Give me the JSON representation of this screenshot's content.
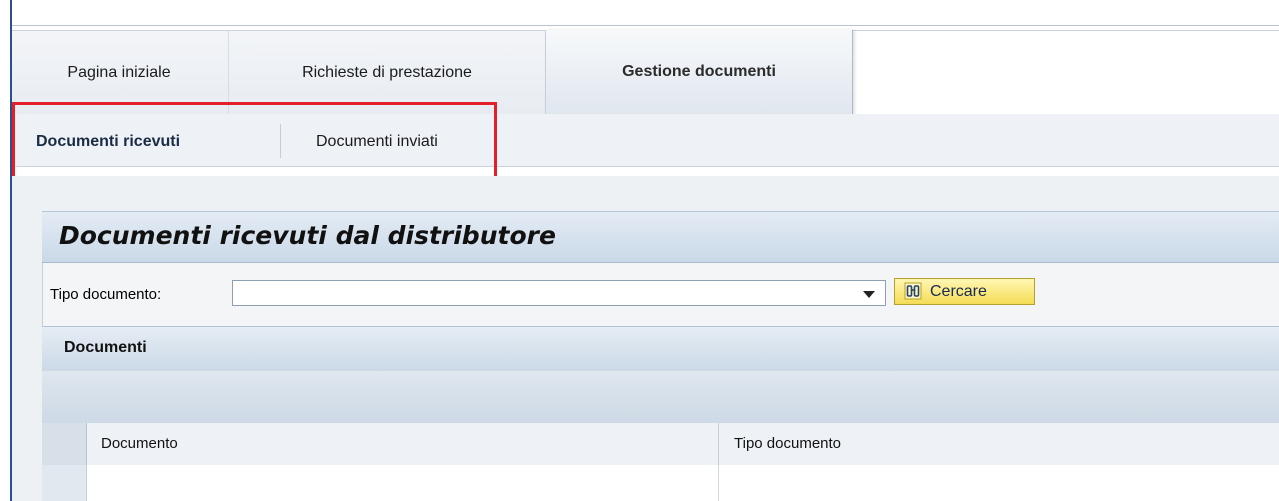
{
  "tabs": [
    {
      "label": "Pagina iniziale",
      "active": false
    },
    {
      "label": "Richieste di prestazione",
      "active": false
    },
    {
      "label": "Gestione documenti",
      "active": true
    }
  ],
  "subtabs": [
    {
      "label": "Documenti ricevuti",
      "active": true
    },
    {
      "label": "Documenti inviati",
      "active": false
    }
  ],
  "panel": {
    "title": "Documenti ricevuti dal distributore"
  },
  "filter": {
    "label": "Tipo documento:",
    "value": "",
    "search_label": "Cercare"
  },
  "table": {
    "title": "Documenti",
    "columns": [
      "Documento",
      "Tipo documento"
    ],
    "rows": [
      [
        "",
        ""
      ]
    ]
  },
  "colors": {
    "highlight": "#e3202a",
    "search_button": "#f4dc55",
    "header_blue": "#c9d8e8"
  },
  "icons": {
    "search": "binoculars-icon",
    "dropdown": "chevron-down-icon"
  }
}
